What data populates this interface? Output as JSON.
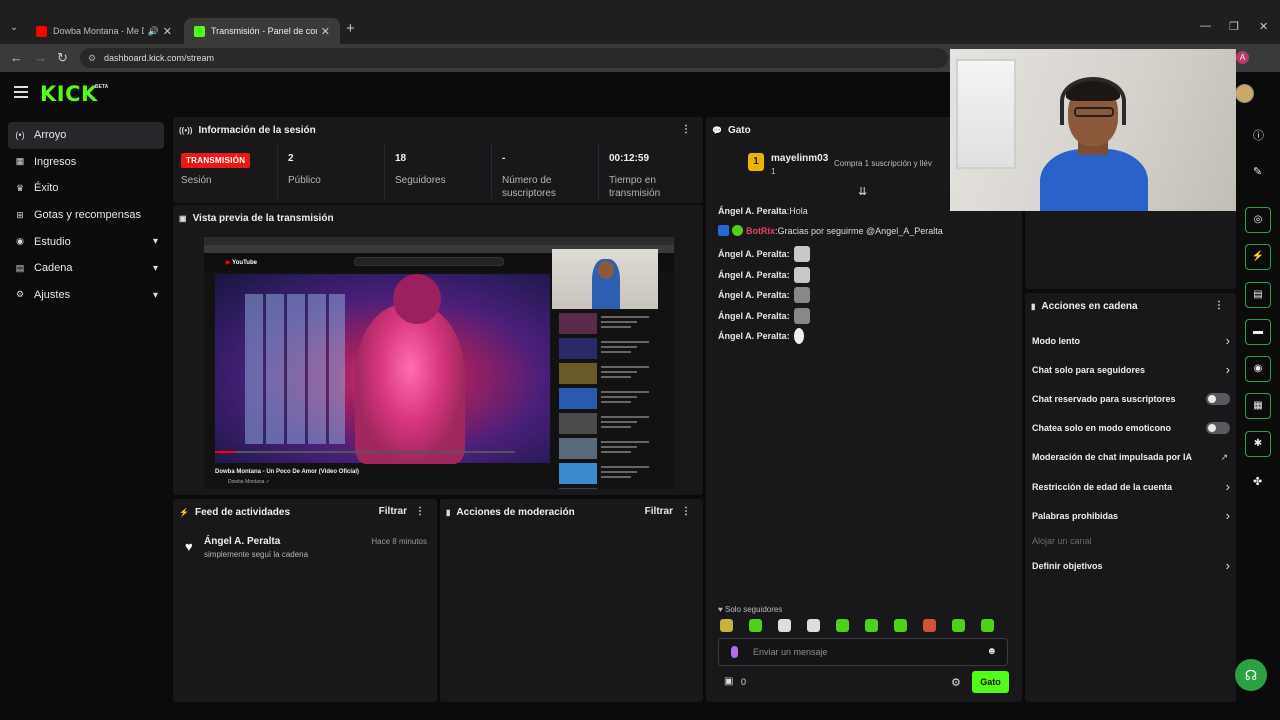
{
  "browser": {
    "tabs": [
      {
        "title": "Dowba Montana - Me Dan Ganas",
        "favicon_color": "#ff0000"
      },
      {
        "title": "Transmisión - Panel de control",
        "favicon_color": "#53fc18"
      }
    ],
    "url": "dashboard.kick.com/stream",
    "profile_initial": "A"
  },
  "app": {
    "logo": "KICK",
    "beta": "BETA"
  },
  "nav": {
    "items": [
      {
        "label": "Arroyo",
        "icon": "stream-icon",
        "glyph": "((•))",
        "active": true,
        "expandable": false
      },
      {
        "label": "Ingresos",
        "icon": "chart-icon",
        "glyph": "▦",
        "active": false,
        "expandable": false
      },
      {
        "label": "Éxito",
        "icon": "trophy-icon",
        "glyph": "🏆",
        "active": false,
        "expandable": false
      },
      {
        "label": "Gotas y recompensas",
        "icon": "gift-icon",
        "glyph": "⊞",
        "active": false,
        "expandable": false
      },
      {
        "label": "Estudio",
        "icon": "camera-icon",
        "glyph": "◉",
        "active": false,
        "expandable": true
      },
      {
        "label": "Cadena",
        "icon": "channel-icon",
        "glyph": "▤",
        "active": false,
        "expandable": true
      },
      {
        "label": "Ajustes",
        "icon": "settings-icon",
        "glyph": "⚙",
        "active": false,
        "expandable": true
      }
    ]
  },
  "session": {
    "title": "Información de la sesión",
    "live_badge": "TRANSMISIÓN",
    "session_label": "Sesión",
    "stats": [
      {
        "value": "2",
        "label": "Público"
      },
      {
        "value": "18",
        "label": "Seguidores"
      },
      {
        "value": "-",
        "label": "Número de suscriptores"
      },
      {
        "value": "00:12:59",
        "label": "Tiempo en transmisión"
      }
    ]
  },
  "preview": {
    "title": "Vista previa de la transmisión",
    "video_title": "Dowba Montana - Un Poco De Amor (Video Oficial)",
    "channel": "Dowba Montana ✓"
  },
  "activity": {
    "title": "Feed de actividades",
    "filter": "Filtrar",
    "items": [
      {
        "name": "Ángel A. Peralta",
        "text": "simplemente seguí la cadena",
        "time": "Hace 8 minutos"
      }
    ]
  },
  "moderation": {
    "title": "Acciones de moderación",
    "filter": "Filtrar"
  },
  "chat": {
    "title": "Gato",
    "pinned": {
      "badge": "1",
      "user": "mayelinm03",
      "count": "1",
      "gift_text": "Compra 1 suscripción y llév"
    },
    "messages": [
      {
        "user": "Ángel A. Peralta",
        "text": " Hola",
        "emote": false,
        "style": "normal"
      },
      {
        "user": "BotRix",
        "text": " Gracias por seguirme @Angel_A_Peralta",
        "emote": false,
        "style": "bot"
      },
      {
        "user": "Ángel A. Peralta:",
        "text": "",
        "emote": true,
        "style": "normal"
      },
      {
        "user": "Ángel A. Peralta:",
        "text": "",
        "emote": true,
        "style": "normal"
      },
      {
        "user": "Ángel A. Peralta:",
        "text": "",
        "emote": true,
        "style": "normal"
      },
      {
        "user": "Ángel A. Peralta:",
        "text": "",
        "emote": true,
        "style": "normal"
      },
      {
        "user": "Ángel A. Peralta:",
        "text": "",
        "emote": true,
        "style": "normal"
      }
    ],
    "follow_only": "Solo seguidores",
    "input_placeholder": "Enviar un mensaje",
    "viewer_count": "0",
    "send_label": "Gato"
  },
  "chain_actions": {
    "title": "Acciones en cadena",
    "items": [
      {
        "label": "Modo lento",
        "control": "chevron"
      },
      {
        "label": "Chat solo para seguidores",
        "control": "chevron"
      },
      {
        "label": "Chat reservado para suscriptores",
        "control": "toggle",
        "on": false
      },
      {
        "label": "Chatea solo en modo emoticono",
        "control": "toggle",
        "on": false
      },
      {
        "label": "Moderación de chat impulsada por IA",
        "control": "external"
      },
      {
        "label": "Restricción de edad de la cuenta",
        "control": "chevron"
      },
      {
        "label": "Palabras prohibidas",
        "control": "chevron"
      },
      {
        "label": "Alojar un canal",
        "control": "none",
        "disabled": true
      },
      {
        "label": "Definir objetivos",
        "control": "chevron"
      }
    ]
  }
}
